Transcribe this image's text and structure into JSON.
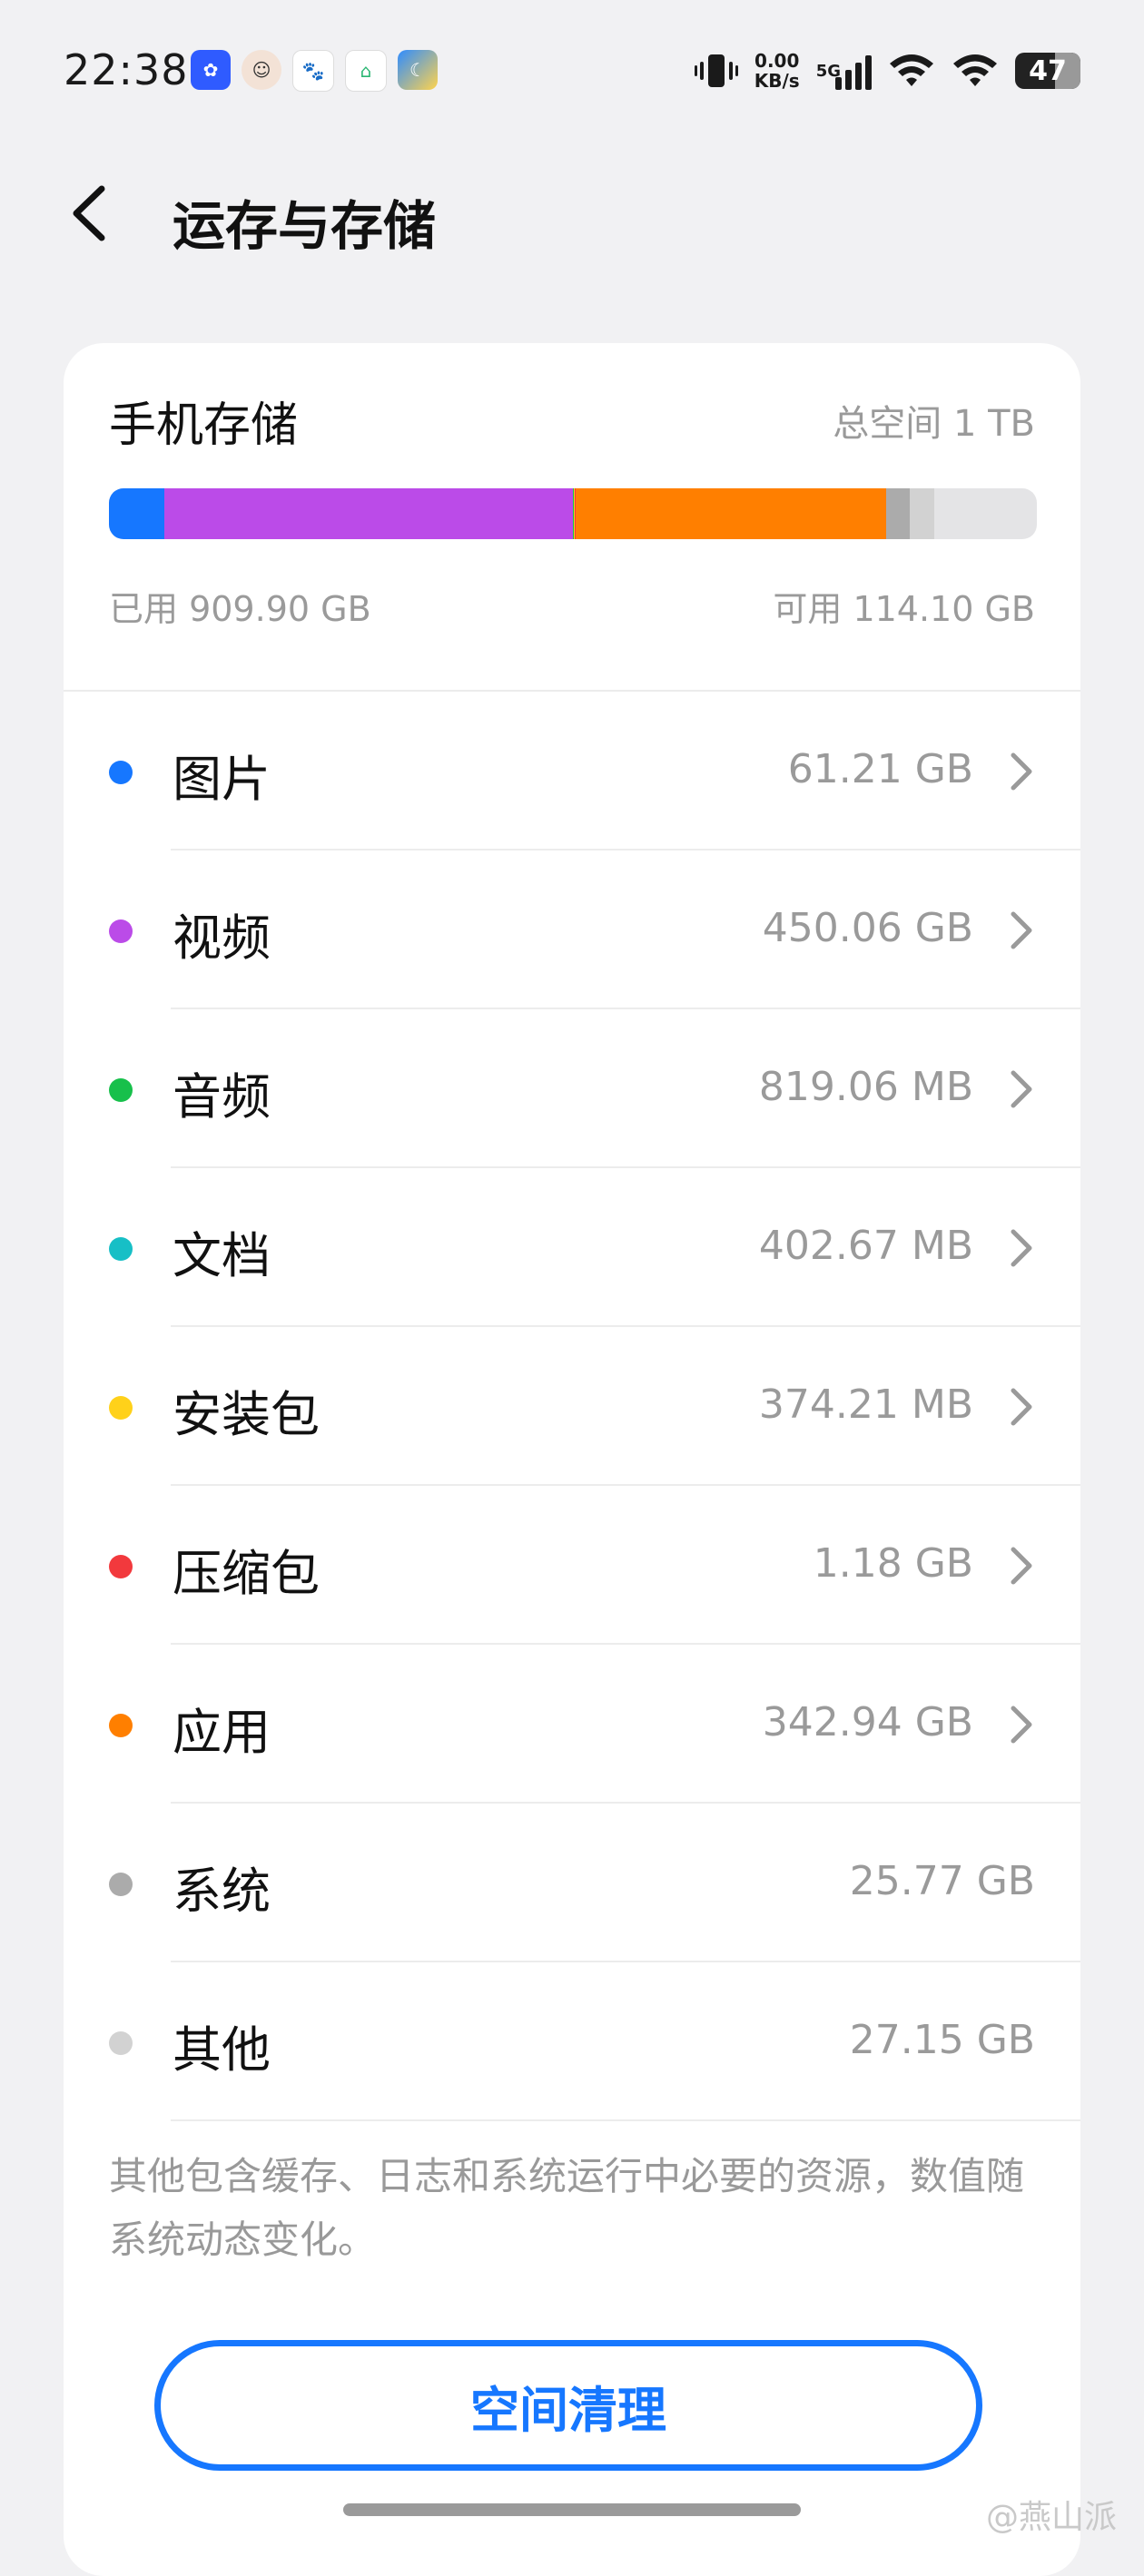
{
  "status_bar": {
    "time": "22:38",
    "net_speed_value": "0.00",
    "net_speed_unit": "KB/s",
    "net_type": "5G",
    "battery": "47"
  },
  "header": {
    "title": "运存与存储"
  },
  "storage": {
    "title": "手机存储",
    "total": "总空间 1 TB",
    "used": "已用 909.90 GB",
    "available": "可用 114.10 GB",
    "categories": [
      {
        "name": "图片",
        "size": "61.21 GB",
        "color": "#1677FF",
        "arrow": true,
        "share": 0.06
      },
      {
        "name": "视频",
        "size": "450.06 GB",
        "color": "#BB4BE8",
        "arrow": true,
        "share": 0.44
      },
      {
        "name": "音频",
        "size": "819.06 MB",
        "color": "#17C04B",
        "arrow": true,
        "share": 0.0008
      },
      {
        "name": "文档",
        "size": "402.67 MB",
        "color": "#17BFC6",
        "arrow": true,
        "share": 0.0004
      },
      {
        "name": "安装包",
        "size": "374.21 MB",
        "color": "#FFD11A",
        "arrow": true,
        "share": 0.0004
      },
      {
        "name": "压缩包",
        "size": "1.18 GB",
        "color": "#F2393D",
        "arrow": true,
        "share": 0.0012
      },
      {
        "name": "应用",
        "size": "342.94 GB",
        "color": "#FF7F00",
        "arrow": true,
        "share": 0.335
      },
      {
        "name": "系统",
        "size": "25.77 GB",
        "color": "#ABABAB",
        "arrow": false,
        "share": 0.025
      },
      {
        "name": "其他",
        "size": "27.15 GB",
        "color": "#D2D2D2",
        "arrow": false,
        "share": 0.0265
      }
    ],
    "note": "其他包含缓存、日志和系统运行中必要的资源，数值随系统动态变化。",
    "clean_button": "空间清理"
  },
  "watermark": "@燕山派"
}
